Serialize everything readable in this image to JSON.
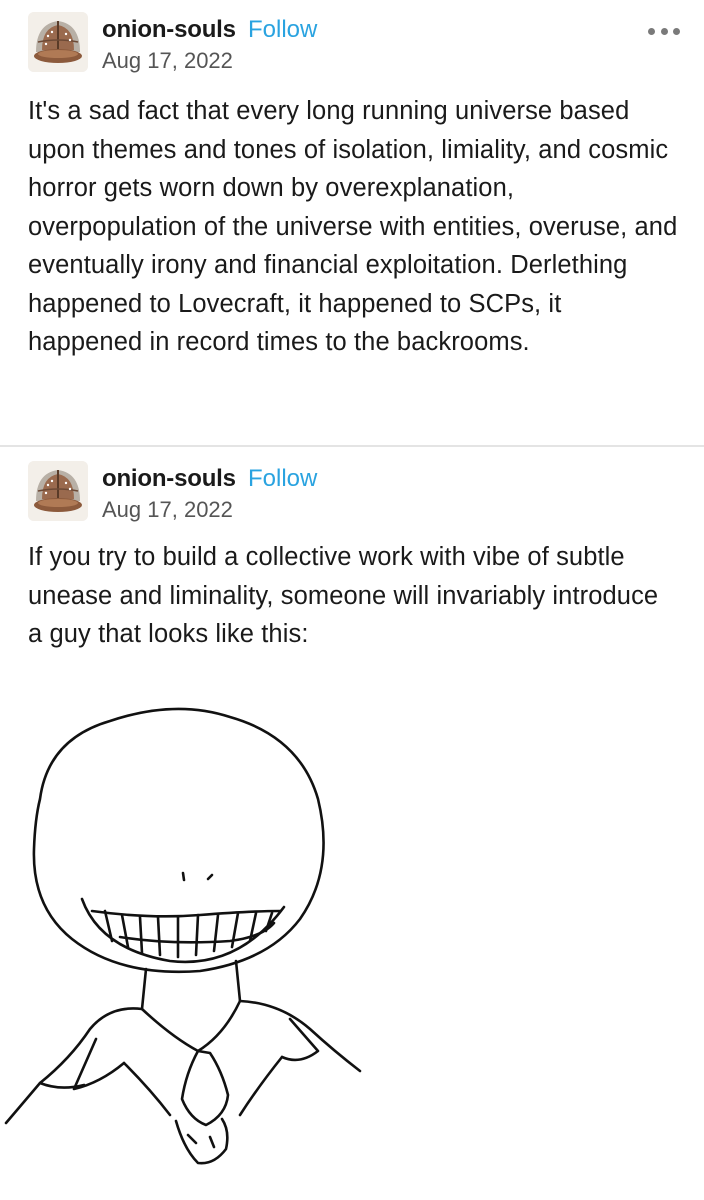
{
  "posts": [
    {
      "username": "onion-souls",
      "follow_label": "Follow",
      "date": "Aug 17, 2022",
      "more_icon": "ellipsis-icon",
      "text": "It's a sad fact that every long running universe based upon themes and tones of isolation, limiality, and cosmic horror gets worn down by overexplanation, overpopulation of the universe with entities, overuse, and eventually irony and financial exploitation. Derlething happened to Lovecraft, it happened to SCPs, it happened in record times to the backrooms."
    },
    {
      "username": "onion-souls",
      "follow_label": "Follow",
      "date": "Aug 17, 2022",
      "text": "If you try to build a collective work with vibe of subtle unease and liminality, someone will invariably introduce a guy that looks like this:"
    }
  ],
  "colors": {
    "follow": "#2aa3e0",
    "text": "#1a1a1a",
    "date": "#555555",
    "divider": "#e4e4e4"
  }
}
